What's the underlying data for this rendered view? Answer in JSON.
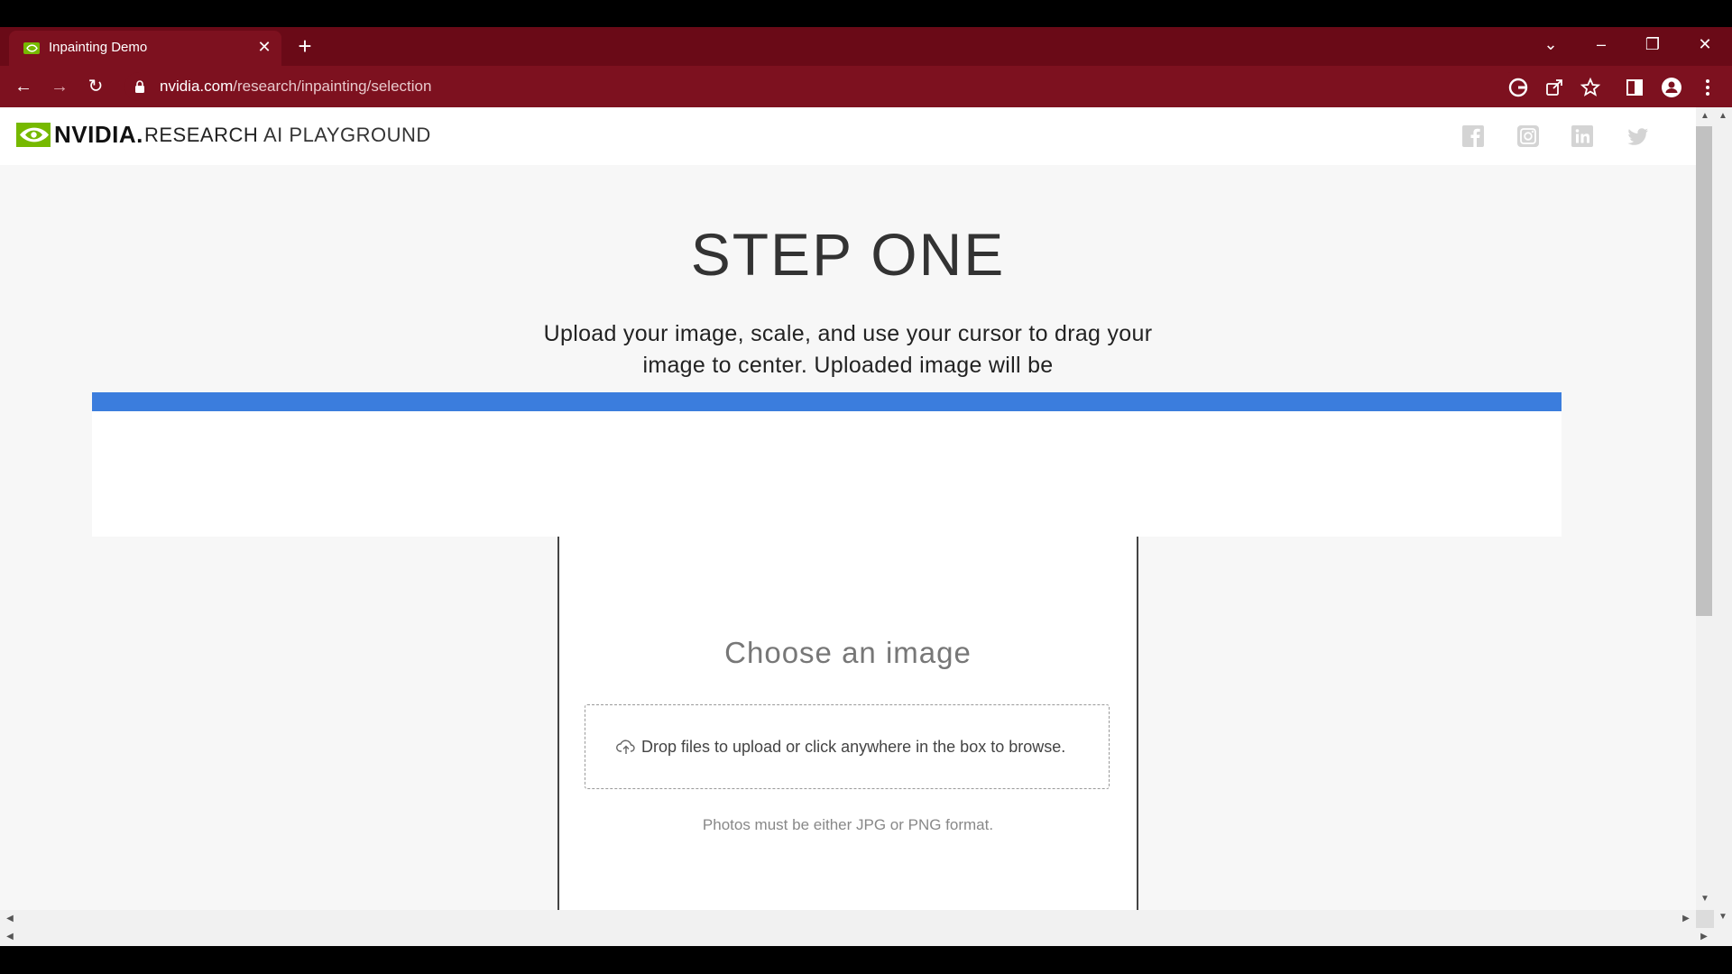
{
  "browser": {
    "tab": {
      "title": "Inpainting Demo"
    },
    "url": {
      "host": "nvidia.com",
      "path": "/research/inpainting/selection"
    },
    "colors": {
      "frame": "#6a0a17",
      "toolbar": "#7d111f"
    }
  },
  "header": {
    "brand_nvidia": "NVIDIA.",
    "brand_research": "RESEARCH",
    "brand_playground": "AI PLAYGROUND",
    "social_icons": [
      "facebook-icon",
      "instagram-icon",
      "linkedin-icon",
      "twitter-icon"
    ]
  },
  "main": {
    "step_title": "STEP ONE",
    "step_description": "Upload your image, scale, and use your cursor to drag your image to center. Uploaded image will be",
    "accent_color": "#3b7ddd"
  },
  "upload": {
    "choose_title": "Choose an image",
    "drop_text": "Drop files to upload or click anywhere in the box to browse.",
    "format_note": "Photos must be either JPG or PNG format."
  }
}
